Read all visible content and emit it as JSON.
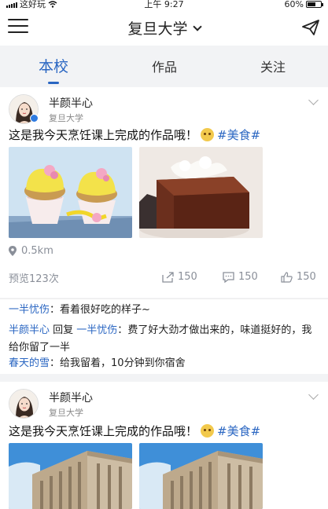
{
  "status_bar": {
    "carrier": "这好玩",
    "time": "上午 9:27",
    "battery": "60%",
    "battery_level": 0.6
  },
  "navbar": {
    "title": "复旦大学",
    "icons": {
      "menu": "menu-icon",
      "dropdown": "chevron-down-icon",
      "send": "send-icon"
    }
  },
  "tabs": [
    {
      "label": "本校",
      "active": true
    },
    {
      "label": "作品",
      "active": false
    },
    {
      "label": "关注",
      "active": false
    }
  ],
  "colors": {
    "accent": "#2a66c2",
    "muted": "#8a8f99",
    "background": "#f2f3f5"
  },
  "posts": [
    {
      "user": "半颜半心",
      "school": "复旦大学",
      "text": "这是我今天烹饪课上完成的作品哦！",
      "tag": "#美食#",
      "images": [
        "cupcakes-photo",
        "chocolate-cake-photo"
      ],
      "distance": "0.5km",
      "views": "预览123次",
      "shares": "150",
      "comments_count": "150",
      "likes": "150",
      "comments": [
        {
          "author": "一半忧伤",
          "separator": "：",
          "text": "看着很好吃的样子~"
        },
        {
          "author": "半颜半心",
          "reply_word": " 回复 ",
          "reply_to": "一半忧伤",
          "separator": "：",
          "text": "费了好大劲才做出来的，味道挺好的，我给你留了一半"
        },
        {
          "author": "春天的雪",
          "separator": "：",
          "text": "给我留着，10分钟到你宿舍"
        }
      ]
    },
    {
      "user": "半颜半心",
      "school": "复旦大学",
      "text": "这是我今天烹饪课上完成的作品哦！",
      "tag": "#美食#",
      "images": [
        "campus-building-photo",
        "campus-building-photo"
      ]
    }
  ]
}
